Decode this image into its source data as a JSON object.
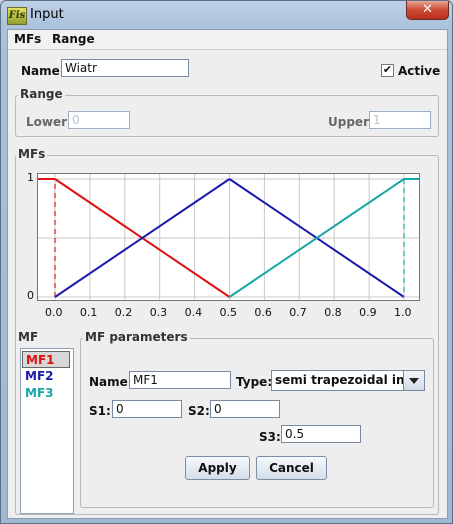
{
  "window": {
    "title": "Input",
    "app_icon_text": "Fis",
    "close_label": "✕"
  },
  "menu": {
    "items": [
      "MFs",
      "Range"
    ]
  },
  "variable": {
    "name_label": "Name:",
    "name_value": "Wiatr",
    "active_label": "Active",
    "active_checked": true
  },
  "range": {
    "title": "Range",
    "lower_label": "Lower:",
    "lower_value": "0",
    "upper_label": "Upper:",
    "upper_value": "1"
  },
  "mfs_panel": {
    "title": "MFs"
  },
  "chart_data": {
    "type": "line",
    "x_ticks": [
      "0.0",
      "0.1",
      "0.2",
      "0.3",
      "0.4",
      "0.5",
      "0.6",
      "0.7",
      "0.8",
      "0.9",
      "1.0"
    ],
    "y_ticks": [
      "0",
      "1"
    ],
    "xlim": [
      0,
      1
    ],
    "ylim": [
      0,
      1
    ],
    "grid": true,
    "series": [
      {
        "key": "MF1",
        "color": "#dd1111",
        "x": [
          0.0,
          0.0,
          0.5
        ],
        "y": [
          0.0,
          1.0,
          0.0
        ],
        "segments_dashed": [
          true,
          false
        ]
      },
      {
        "key": "MF2",
        "color": "#1a1aaa",
        "x": [
          0.0,
          0.5,
          1.0
        ],
        "y": [
          0.0,
          1.0,
          0.0
        ],
        "segments_dashed": [
          false,
          false
        ]
      },
      {
        "key": "MF3",
        "color": "#18a6a6",
        "x": [
          0.5,
          1.0,
          1.0
        ],
        "y": [
          0.0,
          1.0,
          0.0
        ],
        "segments_dashed": [
          false,
          true
        ]
      }
    ]
  },
  "mf_list": {
    "title": "MF",
    "items": [
      {
        "label": "MF1",
        "color": "#dd1111",
        "selected": true
      },
      {
        "label": "MF2",
        "color": "#1a1aaa",
        "selected": false
      },
      {
        "label": "MF3",
        "color": "#18a6a6",
        "selected": false
      }
    ]
  },
  "mf_params": {
    "title": "MF parameters",
    "name_label": "Name:",
    "name_value": "MF1",
    "type_label": "Type:",
    "type_value": "semi trapezoidal inf.",
    "s1_label": "S1:",
    "s1_value": "0",
    "s2_label": "S2:",
    "s2_value": "0",
    "s3_label": "S3:",
    "s3_value": "0.5",
    "apply_label": "Apply",
    "cancel_label": "Cancel"
  }
}
